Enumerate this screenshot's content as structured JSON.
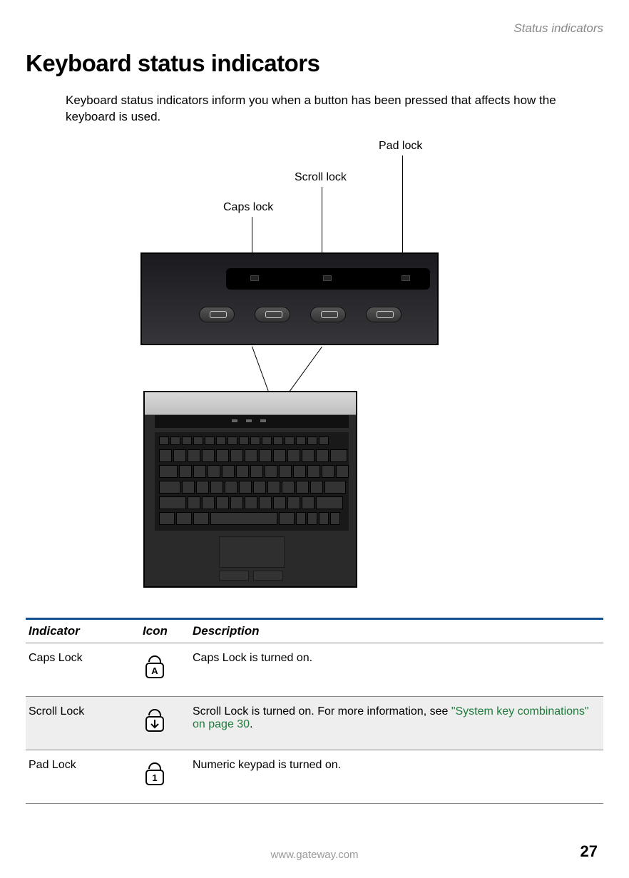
{
  "header": {
    "section": "Status indicators"
  },
  "title": "Keyboard status indicators",
  "intro": "Keyboard status indicators inform you when a button has been pressed that affects how the keyboard is used.",
  "diagram": {
    "labels": {
      "pad": "Pad lock",
      "scroll": "Scroll lock",
      "caps": "Caps lock"
    }
  },
  "table": {
    "headers": {
      "indicator": "Indicator",
      "icon": "Icon",
      "description": "Description"
    },
    "rows": [
      {
        "indicator": "Caps Lock",
        "icon_char": "A",
        "desc_plain": "Caps Lock is turned on."
      },
      {
        "indicator": "Scroll Lock",
        "icon_char": "↓",
        "desc_before": "Scroll Lock is turned on. For more information, see ",
        "desc_link": "\"System key combinations\" on page 30",
        "desc_after": "."
      },
      {
        "indicator": "Pad Lock",
        "icon_char": "1",
        "desc_plain": "Numeric keypad is turned on."
      }
    ]
  },
  "footer": {
    "url": "www.gateway.com",
    "page": "27"
  }
}
